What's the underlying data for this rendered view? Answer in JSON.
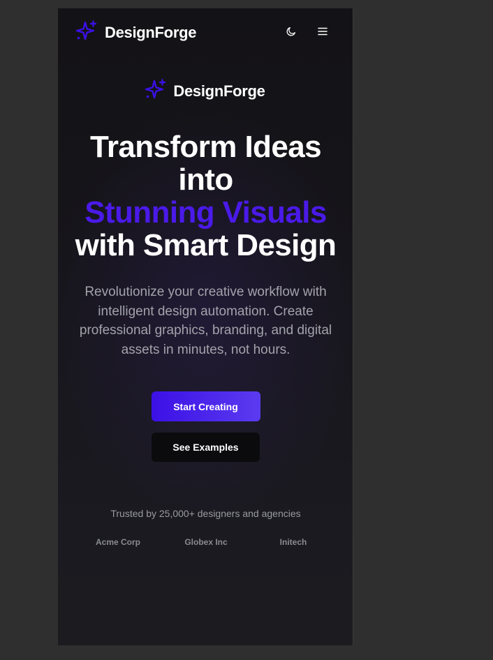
{
  "nav": {
    "brand": "DesignForge",
    "theme_icon": "moon-icon",
    "menu_icon": "hamburger-menu-icon"
  },
  "hero": {
    "brand": "DesignForge",
    "brand_icon": "sparkles-icon",
    "headline_line1": "Transform Ideas into",
    "headline_accent": "Stunning Visuals",
    "headline_line2": "with Smart Design",
    "subtext": "Revolutionize your creative workflow with intelligent design automation. Create professional graphics, branding, and digital assets in minutes, not hours.",
    "primary_cta": "Start Creating",
    "secondary_cta": "See Examples"
  },
  "trust": {
    "text": "Trusted by 25,000+ designers and agencies",
    "logos": [
      "Acme Corp",
      "Globex Inc",
      "Initech"
    ]
  },
  "colors": {
    "accent": "#4a1ae8",
    "background": "#16151a",
    "page_backdrop": "#2f2f2f"
  }
}
